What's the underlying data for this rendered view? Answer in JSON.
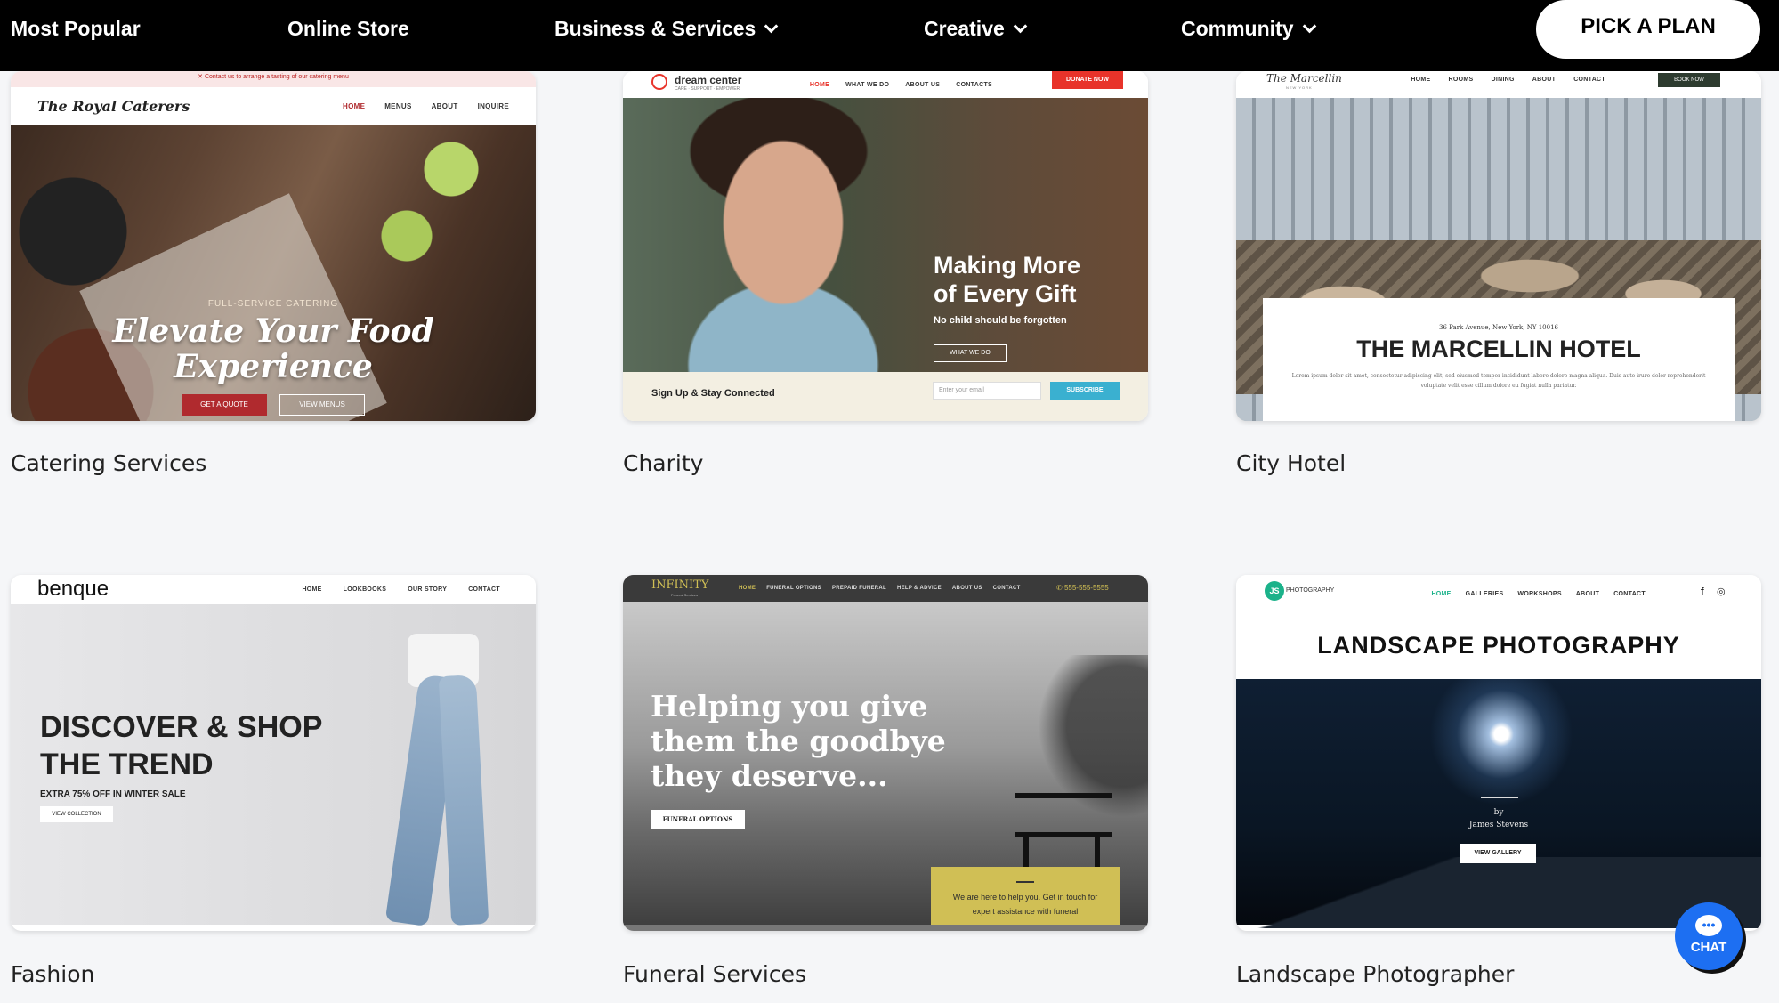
{
  "nav": {
    "items": [
      {
        "label": "Most Popular",
        "dropdown": false
      },
      {
        "label": "Online Store",
        "dropdown": false
      },
      {
        "label": "Business & Services",
        "dropdown": true
      },
      {
        "label": "Creative",
        "dropdown": true
      },
      {
        "label": "Community",
        "dropdown": true
      }
    ],
    "cta": "PICK A PLAN"
  },
  "templates": [
    {
      "label": "Catering Services",
      "preview": {
        "topbar": "Contact us to arrange a tasting of our catering menu",
        "brand": "The Royal Caterers",
        "links": [
          "HOME",
          "MENUS",
          "ABOUT",
          "INQUIRE"
        ],
        "kicker": "FULL-SERVICE CATERING",
        "headline_1": "Elevate Your Food",
        "headline_2": "Experience",
        "btn_primary": "GET A QUOTE",
        "btn_secondary": "VIEW MENUS"
      }
    },
    {
      "label": "Charity",
      "preview": {
        "brand": "dream center",
        "tagline": "CARE · SUPPORT · EMPOWER",
        "links": [
          "HOME",
          "WHAT WE DO",
          "ABOUT US",
          "CONTACTS"
        ],
        "donate": "DONATE NOW",
        "headline_1": "Making More",
        "headline_2": "of Every Gift",
        "sub": "No child should be forgotten",
        "btn": "WHAT WE DO",
        "footer_text": "Sign Up & Stay Connected",
        "email_placeholder": "Enter your email",
        "subscribe": "SUBSCRIBE"
      }
    },
    {
      "label": "City Hotel",
      "preview": {
        "brand": "The Marcellin",
        "brand_sub": "NEW YORK",
        "links": [
          "HOME",
          "ROOMS",
          "DINING",
          "ABOUT",
          "CONTACT"
        ],
        "book": "BOOK NOW",
        "address": "36 Park Avenue, New York, NY 10016",
        "title": "THE MARCELLIN HOTEL",
        "body": "Lorem ipsum dolor sit amet, consectetur adipiscing elit, sed eiusmod tempor incididunt labore dolore magna aliqua. Duis aute irure dolor reprehenderit voluptate velit esse cillum dolore eu fugiat nulla pariatur."
      }
    },
    {
      "label": "Fashion",
      "preview": {
        "brand": "benque",
        "links": [
          "HOME",
          "LOOKBOOKS",
          "OUR STORY",
          "CONTACT"
        ],
        "headline_1": "DISCOVER & SHOP",
        "headline_2": "THE TREND",
        "sub": "EXTRA 75% OFF IN WINTER SALE",
        "btn": "VIEW COLLECTION"
      }
    },
    {
      "label": "Funeral Services",
      "preview": {
        "brand": "INFINITY",
        "brand_sub": "Funeral Services",
        "links": [
          "HOME",
          "FUNERAL OPTIONS",
          "PREPAID FUNERAL",
          "HELP & ADVICE",
          "ABOUT US",
          "CONTACT"
        ],
        "phone": "555-555-5555",
        "headline_1": "Helping you give",
        "headline_2": "them the goodbye",
        "headline_3": "they deserve...",
        "btn": "FUNERAL OPTIONS",
        "box_1": "We are here to help you. Get in touch for",
        "box_2": "expert assistance with funeral"
      }
    },
    {
      "label": "Landscape Photographer",
      "preview": {
        "brand_badge": "JS",
        "brand": "PHOTOGRAPHY",
        "links": [
          "HOME",
          "GALLERIES",
          "WORKSHOPS",
          "ABOUT",
          "CONTACT"
        ],
        "social_1": "f",
        "social_2": "◎",
        "title": "LANDSCAPE PHOTOGRAPHY",
        "by": "by",
        "author": "James Stevens",
        "btn": "VIEW GALLERY"
      }
    }
  ],
  "chat": {
    "label": "CHAT",
    "icon": "chat-bubble-icon",
    "color": "#1d6ff2"
  },
  "colors": {
    "nav_bg": "#000000",
    "page_bg": "#f5f6f8",
    "catering_red": "#b02a2e",
    "charity_red": "#e8332a",
    "subscribe_blue": "#3ab0d0",
    "funeral_gold": "#d0bf55"
  }
}
